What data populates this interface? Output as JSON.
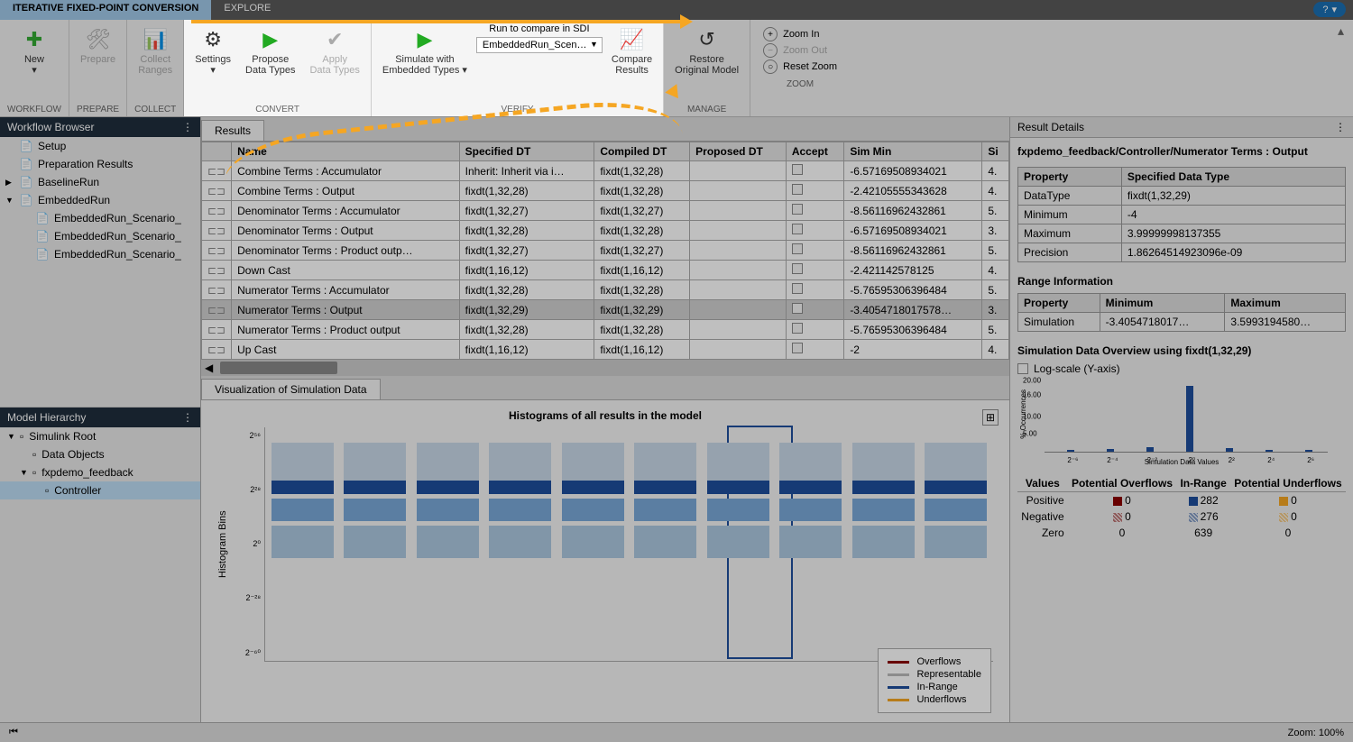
{
  "tabs": {
    "active": "ITERATIVE FIXED-POINT CONVERSION",
    "other": "EXPLORE",
    "help": "?"
  },
  "toolstrip": {
    "workflow": {
      "new": "New",
      "group": "WORKFLOW"
    },
    "prepare": {
      "prepare": "Prepare",
      "group": "PREPARE"
    },
    "collect": {
      "collect": "Collect\nRanges",
      "group": "COLLECT"
    },
    "convert": {
      "settings": "Settings",
      "propose": "Propose\nData Types",
      "apply": "Apply\nData Types",
      "group": "CONVERT"
    },
    "verify": {
      "simulate": "Simulate with\nEmbedded Types",
      "runlabel": "Run to compare in SDI",
      "runsel": "EmbeddedRun_Scen…",
      "compare": "Compare\nResults",
      "group": "VERIFY"
    },
    "manage": {
      "restore": "Restore\nOriginal Model",
      "group": "MANAGE"
    },
    "zoom": {
      "in": "Zoom In",
      "out": "Zoom Out",
      "reset": "Reset Zoom",
      "group": "ZOOM"
    }
  },
  "workflowBrowser": {
    "title": "Workflow Browser",
    "items": [
      {
        "label": "Setup",
        "level": 1,
        "arrow": ""
      },
      {
        "label": "Preparation Results",
        "level": 1,
        "arrow": ""
      },
      {
        "label": "BaselineRun",
        "level": 1,
        "arrow": "▶"
      },
      {
        "label": "EmbeddedRun",
        "level": 1,
        "arrow": "▼"
      },
      {
        "label": "EmbeddedRun_Scenario_",
        "level": 2,
        "arrow": ""
      },
      {
        "label": "EmbeddedRun_Scenario_",
        "level": 2,
        "arrow": ""
      },
      {
        "label": "EmbeddedRun_Scenario_",
        "level": 2,
        "arrow": ""
      }
    ]
  },
  "modelHierarchy": {
    "title": "Model Hierarchy",
    "items": [
      {
        "label": "Simulink Root",
        "level": 1,
        "arrow": "▼"
      },
      {
        "label": "Data Objects",
        "level": 2,
        "arrow": ""
      },
      {
        "label": "fxpdemo_feedback",
        "level": 2,
        "arrow": "▼"
      },
      {
        "label": "Controller",
        "level": 3,
        "arrow": "",
        "sel": true
      }
    ]
  },
  "resultsTab": "Results",
  "resultsCols": [
    "",
    "Name",
    "Specified DT",
    "Compiled DT",
    "Proposed DT",
    "Accept",
    "Sim Min",
    "Si"
  ],
  "resultsRows": [
    {
      "name": "Combine Terms : Accumulator",
      "spec": "Inherit: Inherit via i…",
      "comp": "fixdt(1,32,28)",
      "prop": "",
      "min": "-6.57169508934021",
      "si": "4."
    },
    {
      "name": "Combine Terms : Output",
      "spec": "fixdt(1,32,28)",
      "comp": "fixdt(1,32,28)",
      "prop": "",
      "min": "-2.42105555343628",
      "si": "4."
    },
    {
      "name": "Denominator Terms : Accumulator",
      "spec": "fixdt(1,32,27)",
      "comp": "fixdt(1,32,27)",
      "prop": "",
      "min": "-8.56116962432861",
      "si": "5."
    },
    {
      "name": "Denominator Terms : Output",
      "spec": "fixdt(1,32,28)",
      "comp": "fixdt(1,32,28)",
      "prop": "",
      "min": "-6.57169508934021",
      "si": "3."
    },
    {
      "name": "Denominator Terms : Product outp…",
      "spec": "fixdt(1,32,27)",
      "comp": "fixdt(1,32,27)",
      "prop": "",
      "min": "-8.56116962432861",
      "si": "5."
    },
    {
      "name": "Down Cast",
      "spec": "fixdt(1,16,12)",
      "comp": "fixdt(1,16,12)",
      "prop": "",
      "min": "-2.421142578125",
      "si": "4."
    },
    {
      "name": "Numerator Terms : Accumulator",
      "spec": "fixdt(1,32,28)",
      "comp": "fixdt(1,32,28)",
      "prop": "",
      "min": "-5.76595306396484",
      "si": "5."
    },
    {
      "name": "Numerator Terms : Output",
      "spec": "fixdt(1,32,29)",
      "comp": "fixdt(1,32,29)",
      "prop": "",
      "min": "-3.4054718017578…",
      "si": "3.",
      "sel": true
    },
    {
      "name": "Numerator Terms : Product output",
      "spec": "fixdt(1,32,28)",
      "comp": "fixdt(1,32,28)",
      "prop": "",
      "min": "-5.76595306396484",
      "si": "5."
    },
    {
      "name": "Up Cast",
      "spec": "fixdt(1,16,12)",
      "comp": "fixdt(1,16,12)",
      "prop": "",
      "min": "-2",
      "si": "4."
    }
  ],
  "vizTab": "Visualization of Simulation Data",
  "vizTitle": "Histograms of all results in the model",
  "vizYLabel": "Histogram Bins",
  "vizYTicks": [
    "2⁵⁶",
    "2²⁸",
    "2⁰",
    "2⁻²⁸",
    "2⁻⁶⁰"
  ],
  "legend": {
    "overflows": "Overflows",
    "repr": "Representable",
    "inrange": "In-Range",
    "under": "Underflows"
  },
  "resultDetails": {
    "title": "Result Details",
    "path": "fxpdemo_feedback/Controller/Numerator Terms : Output",
    "propHdr": [
      "Property",
      "Specified Data Type"
    ],
    "props": [
      [
        "DataType",
        "fixdt(1,32,29)"
      ],
      [
        "Minimum",
        "-4"
      ],
      [
        "Maximum",
        "3.99999998137355"
      ],
      [
        "Precision",
        "1.86264514923096e-09"
      ]
    ],
    "rangeTitle": "Range Information",
    "rangeHdr": [
      "Property",
      "Minimum",
      "Maximum"
    ],
    "rangeRows": [
      [
        "Simulation",
        "-3.4054718017…",
        "3.5993194580…"
      ]
    ],
    "simOverview": "Simulation Data Overview using fixdt(1,32,29)",
    "logscale": "Log-scale (Y-axis)",
    "miniXLabel": "Simulation Data Values",
    "miniYLabel": "% Occurrences",
    "statsHdr": [
      "Values",
      "Potential Overflows",
      "In-Range",
      "Potential Underflows"
    ],
    "statsRows": [
      [
        "Positive",
        "0",
        "282",
        "0"
      ],
      [
        "Negative",
        "0",
        "276",
        "0"
      ],
      [
        "Zero",
        "0",
        "639",
        "0"
      ]
    ]
  },
  "status": {
    "zoom": "Zoom: 100%"
  },
  "chart_data": {
    "type": "bar",
    "title": "Simulation Data Overview using fixdt(1,32,29)",
    "xlabel": "Simulation Data Values",
    "ylabel": "% Occurrences",
    "ylim": [
      0,
      20
    ],
    "categories": [
      "2⁻⁶",
      "2⁻⁴",
      "2⁻²",
      "2⁰",
      "2²",
      "2⁴",
      "2⁶"
    ],
    "values": [
      0.5,
      0.8,
      1.2,
      18.5,
      1.0,
      0.6,
      0.4
    ]
  }
}
